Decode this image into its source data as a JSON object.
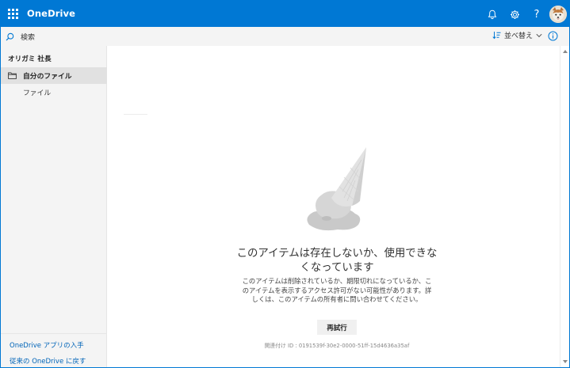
{
  "header": {
    "app_title": "OneDrive",
    "help_label": "?"
  },
  "commandbar": {
    "search_placeholder": "検索",
    "sort_label": "並べ替え"
  },
  "leftnav": {
    "user_name": "オリガミ 社長",
    "items": [
      {
        "label": "自分のファイル",
        "selected": true
      },
      {
        "label": "ファイル",
        "selected": false
      }
    ],
    "bottom_links": [
      {
        "label": "OneDrive アプリの入手"
      },
      {
        "label": "従来の OneDrive に戻す"
      }
    ]
  },
  "error": {
    "title": "このアイテムは存在しないか、使用できなくなっています",
    "description": "このアイテムは削除されているか、期限切れになっているか、このアイテムを表示するアクセス許可がない可能性があります。詳しくは、このアイテムの所有者に問い合わせてください。",
    "retry_label": "再試行",
    "correlation": "関連付け ID : 0191539f-30e2-0000-51ff-15d4636a35af"
  },
  "colors": {
    "brand": "#0078d4",
    "link": "#0064b8",
    "nav_selected": "#e1e1e1"
  },
  "icons": {
    "app_launcher": "waffle-icon",
    "notifications": "bell-icon",
    "settings": "gear-icon",
    "search": "search-icon",
    "sort": "sort-icon",
    "info": "info-icon",
    "folder": "folder-icon",
    "illustration": "dropped-ice-cream-cone"
  }
}
